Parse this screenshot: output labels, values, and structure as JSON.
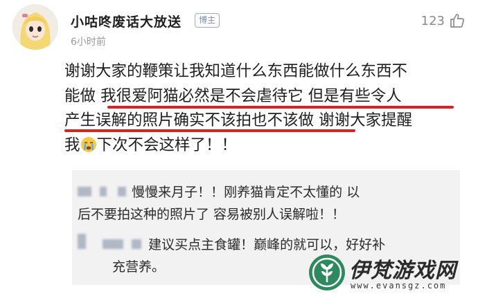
{
  "user": {
    "name": "小咕咚废话大放送",
    "badge": "博主",
    "time": "6小时前"
  },
  "likes": {
    "count": "123",
    "icon": "thumbs-up-icon"
  },
  "comment": {
    "lines": [
      "谢谢大家的鞭策让我知道什么东西能做什么东西不",
      "能做 我很爱阿猫必然是不会虐待它 但是有些令人",
      "产生误解的照片确实不该拍也不该做 谢谢大家提醒"
    ],
    "line4_before": "我",
    "line4_after": "下次不会这样了！！",
    "emoji": "crying-emoji-icon",
    "highlight_color": "#e0201c"
  },
  "replies": [
    {
      "text1": "慢慢来月子！！刚养猫肯定不太懂的 以",
      "text2": "后不要拍这种的照片了 容易被别人误解啦！！"
    },
    {
      "text1": "建议买点主食罐！巅峰的就可以，好好补",
      "text2": "充营养。"
    }
  ],
  "watermark": {
    "title": "伊梵游戏网",
    "url": "www.evansgz.com",
    "logo": "leaf-logo-icon"
  }
}
